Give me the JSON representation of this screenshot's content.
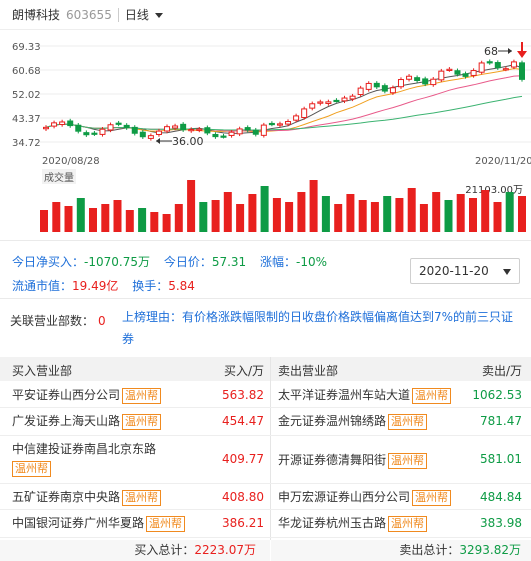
{
  "header": {
    "stock_name": "朗博科技",
    "stock_code": "603655",
    "period": "日线"
  },
  "price_axis": [
    "69.33",
    "60.68",
    "52.02",
    "43.37",
    "34.72"
  ],
  "dates": {
    "start": "2020/08/28",
    "end": "2020/11/20"
  },
  "annotations": {
    "low": "36.00",
    "high": "68"
  },
  "volume": {
    "label": "成交量",
    "max": "21103.00万"
  },
  "stats": {
    "net_buy_label": "今日净买入：",
    "net_buy_value": "-1070.75万",
    "price_label": "今日价：",
    "price_value": "57.31",
    "change_label": "涨幅：",
    "change_value": "-10%",
    "float_cap_label": "流通市值：",
    "float_cap_value": "19.49亿",
    "turnover_label": "换手：",
    "turnover_value": "5.84"
  },
  "date_select": "2020-11-20",
  "dept": {
    "label": "关联营业部数：",
    "count": "0"
  },
  "reason": "上榜理由：有价格涨跌幅限制的日收盘价格跌幅偏离值达到7%的前三只证券",
  "buy_table": {
    "header_name": "买入营业部",
    "header_amount": "买入/万",
    "rows": [
      {
        "name": "平安证券山西分公司",
        "tag": "温州帮",
        "amount": "563.82"
      },
      {
        "name": "广发证券上海天山路",
        "tag": "温州帮",
        "amount": "454.47"
      },
      {
        "name": "中信建投证券南昌北京东路",
        "tag": "温州帮",
        "amount": "409.77"
      },
      {
        "name": "五矿证券南京中央路",
        "tag": "温州帮",
        "amount": "408.80"
      },
      {
        "name": "中国银河证券广州华夏路",
        "tag": "温州帮",
        "amount": "386.21"
      }
    ],
    "total_label": "买入总计：",
    "total_value": "2223.07万"
  },
  "sell_table": {
    "header_name": "卖出营业部",
    "header_amount": "卖出/万",
    "rows": [
      {
        "name": "太平洋证券温州车站大道",
        "tag": "温州帮",
        "amount": "1062.53"
      },
      {
        "name": "金元证券温州锦绣路",
        "tag": "温州帮",
        "amount": "781.47"
      },
      {
        "name": "开源证券德清舞阳街",
        "tag": "温州帮",
        "amount": "581.01"
      },
      {
        "name": "申万宏源证券山西分公司",
        "tag": "温州帮",
        "amount": "484.84"
      },
      {
        "name": "华龙证券杭州玉古路",
        "tag": "温州帮",
        "amount": "383.98"
      }
    ],
    "total_label": "卖出总计：",
    "total_value": "3293.82万"
  },
  "colors": {
    "up": "#e8201e",
    "down": "#0e9b45",
    "ma5": "#555555",
    "ma10": "#f0a020",
    "ma20": "#e85a8a",
    "ma60": "#3cb371",
    "link": "#1e6fd9",
    "tag": "#f08a1f"
  }
}
